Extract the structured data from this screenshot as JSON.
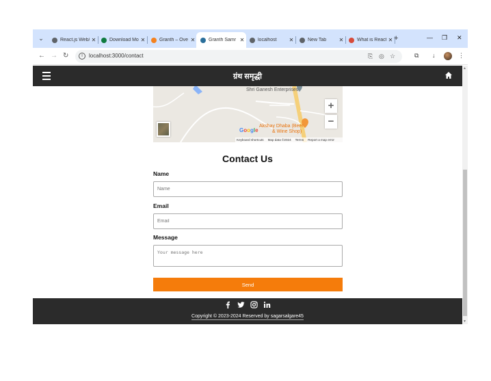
{
  "browser": {
    "tabs": [
      {
        "title": "React.js Web/",
        "color": "#5f6368",
        "active": false
      },
      {
        "title": "Download Mo",
        "color": "#0f7b3f",
        "active": false
      },
      {
        "title": "Granth – Ove",
        "color": "#f4821f",
        "active": false
      },
      {
        "title": "Granth Samr",
        "color": "#2a6f9b",
        "active": true
      },
      {
        "title": "localhost",
        "color": "#5f6368",
        "active": false
      },
      {
        "title": "New Tab",
        "color": "#5f6368",
        "active": false
      },
      {
        "title": "What is React",
        "color": "#d64a3a",
        "active": false
      }
    ],
    "url": "localhost:3000/contact",
    "icons": [
      "dropdown-icon",
      "back-icon",
      "forward-icon",
      "reload-icon",
      "info-icon",
      "install-icon",
      "eye-off-icon",
      "star-icon",
      "extensions-icon",
      "download-icon",
      "profile-icon",
      "menu-dots-icon"
    ]
  },
  "navbar": {
    "brand": "ग्रंथ समृद्धी",
    "icons": [
      "hamburger-menu-icon",
      "home-icon"
    ],
    "color": "#2b2b2b"
  },
  "map": {
    "places": [
      "Shri Ganesh Enterprises",
      "Akshay Dhaba (Beer",
      "& Wine Shop)"
    ],
    "logo": "Google",
    "footer_links": [
      "Keyboard shortcuts",
      "Map data ©2024",
      "Terms",
      "Report a map error"
    ],
    "zoom_in": "+",
    "zoom_out": "−"
  },
  "contact": {
    "title": "Contact Us",
    "name_label": "Name",
    "name_placeholder": "Name",
    "email_label": "Email",
    "email_placeholder": "Email",
    "message_label": "Message",
    "message_placeholder": "Your message here",
    "send_label": "Send",
    "send_color": "#f57c0b"
  },
  "footer": {
    "social_icons": [
      "facebook-icon",
      "twitter-icon",
      "instagram-icon",
      "linkedin-icon"
    ],
    "copyright": "Copyright © 2023-2024 Reserved by sagarsalgare45"
  }
}
